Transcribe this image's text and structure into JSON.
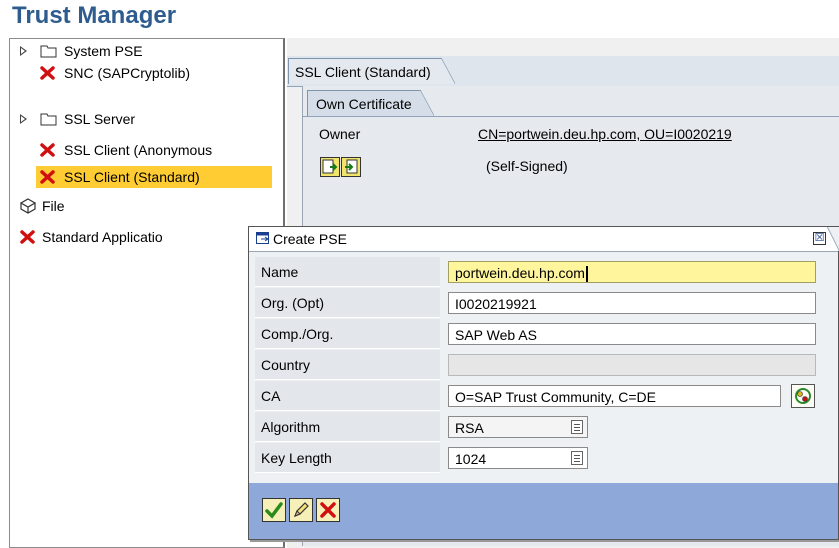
{
  "app_title": "Trust Manager",
  "tree": {
    "items": [
      {
        "label": "System PSE",
        "icon": "folder-icon",
        "expandable": true
      },
      {
        "label": "SNC (SAPCryptolib)",
        "icon": "red-x-icon",
        "expandable": false
      },
      {
        "label": "SSL Server",
        "icon": "folder-icon",
        "expandable": true
      },
      {
        "label": "SSL Client (Anonymous",
        "icon": "red-x-icon",
        "expandable": false
      },
      {
        "label": "SSL Client (Standard)",
        "icon": "red-x-icon",
        "expandable": false,
        "selected": true
      },
      {
        "label": "File",
        "icon": "file-icon",
        "expandable": false
      },
      {
        "label": "Standard Applicatio",
        "icon": "red-x-icon",
        "expandable": false
      }
    ]
  },
  "main": {
    "tab_label": "SSL Client (Standard)",
    "inner_tab_label": "Own Certificate",
    "owner_label": "Owner",
    "owner_value": "CN=portwein.deu.hp.com, OU=I0020219",
    "cert_status": "(Self-Signed)"
  },
  "dialog": {
    "title": "Create PSE",
    "close_symbol": "☒",
    "fields": {
      "name": {
        "label": "Name",
        "value": "portwein.deu.hp.com"
      },
      "org": {
        "label": "Org. (Opt)",
        "value": "I0020219921"
      },
      "comp": {
        "label": "Comp./Org.",
        "value": "SAP Web AS"
      },
      "country": {
        "label": "Country",
        "value": ""
      },
      "ca": {
        "label": "CA",
        "value": "O=SAP Trust Community, C=DE"
      },
      "algorithm": {
        "label": "Algorithm",
        "value": "RSA"
      },
      "keylength": {
        "label": "Key Length",
        "value": "1024"
      }
    }
  },
  "colors": {
    "title": "#2f5c8f",
    "selection": "#ffcc33",
    "focused_input": "#fff59d",
    "footer": "#8ea9d9",
    "red_x": "#d01010"
  }
}
